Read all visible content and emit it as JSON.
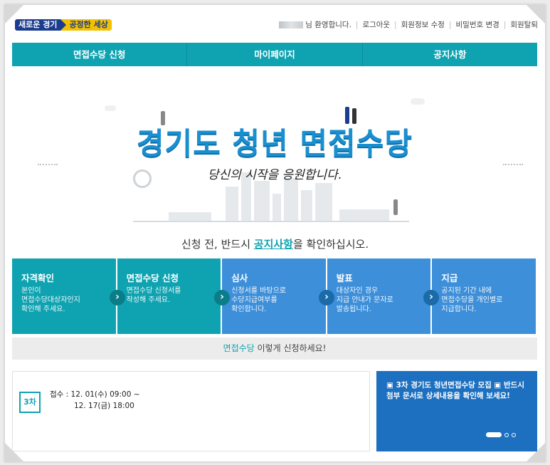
{
  "header": {
    "logo_part1": "새로운 경기",
    "logo_part2": "공정한 세상",
    "welcome": "님 환영합니다.",
    "links": [
      "로그아웃",
      "회원정보 수정",
      "비밀번호 변경",
      "회원탈퇴"
    ]
  },
  "nav": {
    "items": [
      "면접수당 신청",
      "마이페이지",
      "공지사항"
    ]
  },
  "hero": {
    "title": "경기도 청년 면접수당",
    "subtitle": "당신의 시작을 응원합니다."
  },
  "notice": {
    "prefix": "신청 전, 반드시 ",
    "highlight": "공지사항",
    "suffix": "을 확인하십시오."
  },
  "steps": [
    {
      "title": "자격확인",
      "desc1": "본인이",
      "desc2": "면접수당대상자인지",
      "desc3": "확인해 주세요."
    },
    {
      "title": "면접수당 신청",
      "desc1": "면접수당 신청서를",
      "desc2": "작성해 주세요.",
      "desc3": ""
    },
    {
      "title": "심사",
      "desc1": "신청서를 바탕으로",
      "desc2": "수당지급여부를",
      "desc3": "확인합니다."
    },
    {
      "title": "발표",
      "desc1": "대상자인 경우",
      "desc2": "지급 안내가 문자로",
      "desc3": "발송됩니다."
    },
    {
      "title": "지급",
      "desc1": "공지된 기간 내에",
      "desc2": "면접수당을 개인별로",
      "desc3": "지급합니다."
    }
  ],
  "howto": {
    "highlight": "면접수당",
    "text": " 이렇게 신청하세요!"
  },
  "schedule": {
    "round": "3차",
    "line1": "접수 : 12. 01(수) 09:00 ~",
    "line2": "12. 17(금) 18:00"
  },
  "banner": {
    "text": "▣ 3차 경기도 청년면접수당 모집 ▣ 반드시 첨부 문서로 상세내용을 확인해 보세요!"
  },
  "colors": {
    "teal": "#0fa3b1",
    "blue": "#3d8fd9",
    "banner": "#1d70c0"
  }
}
